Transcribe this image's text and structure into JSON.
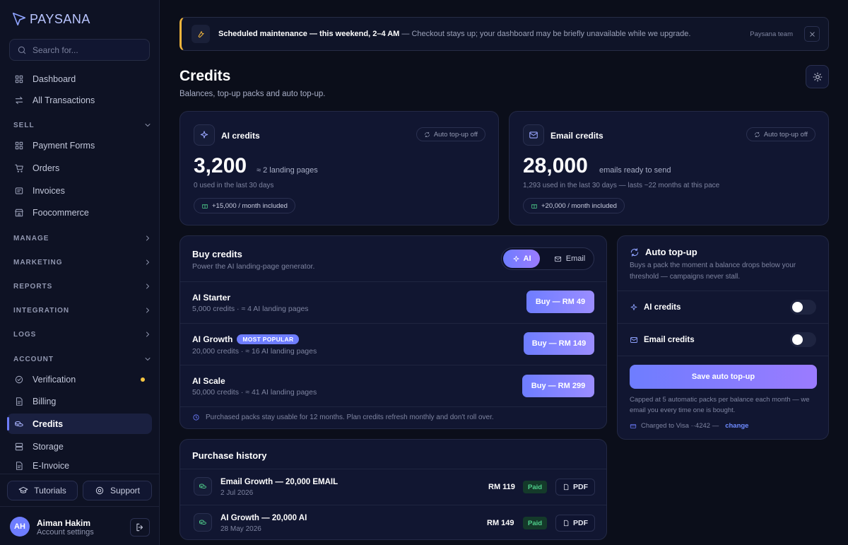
{
  "app": {
    "logo": "PAYSANA"
  },
  "sidebar": {
    "search_placeholder": "Search for...",
    "top_items": [
      {
        "label": "Dashboard",
        "icon": "grid-icon"
      },
      {
        "label": "All Transactions",
        "icon": "arrows-icon"
      }
    ],
    "sections": {
      "sell": "SELL",
      "manage": "MANAGE",
      "marketing": "MARKETING",
      "reports": "REPORTS",
      "integration": "INTEGRATION",
      "logs": "LOGS",
      "account": "ACCOUNT"
    },
    "sell_items": [
      {
        "label": "Payment Forms",
        "icon": "grid-icon"
      },
      {
        "label": "Orders",
        "icon": "cart-icon"
      },
      {
        "label": "Invoices",
        "icon": "invoice-icon"
      },
      {
        "label": "Foocommerce",
        "icon": "store-icon"
      }
    ],
    "account_items": [
      {
        "label": "Verification",
        "icon": "check-circle-icon"
      },
      {
        "label": "Billing",
        "icon": "document-icon"
      },
      {
        "label": "Credits",
        "icon": "coins-icon"
      },
      {
        "label": "Storage",
        "icon": "storage-icon"
      },
      {
        "label": "E-Invoice",
        "icon": "document-icon"
      }
    ],
    "tutorials": "Tutorials",
    "support": "Support",
    "user": {
      "initials": "AH",
      "name": "Aiman Hakim",
      "sub": "Account settings"
    }
  },
  "banner": {
    "title": "Scheduled maintenance — this weekend, 2–4 AM",
    "text": " — Checkout stays up; your dashboard may be briefly unavailable while we upgrade.",
    "team": "Paysana team"
  },
  "page": {
    "title": "Credits",
    "subtitle": "Balances, top-up packs and auto top-up."
  },
  "balances": {
    "ai": {
      "title": "AI credits",
      "auto": "Auto top-up off",
      "value": "3,200",
      "unit": "≈ 2 landing pages",
      "used": "0 used in the last 30 days",
      "included": "+15,000 / month included"
    },
    "email": {
      "title": "Email credits",
      "auto": "Auto top-up off",
      "value": "28,000",
      "unit": "emails ready to send",
      "used": "1,293 used in the last 30 days — lasts ~22 months at this pace",
      "included": "+20,000 / month included"
    }
  },
  "buy": {
    "title": "Buy credits",
    "subtitle": "Power the AI landing-page generator.",
    "tab_ai": "AI",
    "tab_email": "Email",
    "packs": [
      {
        "name": "AI Starter",
        "sub": "5,000 credits · ≈ 4 AI landing pages",
        "button": "Buy — RM 49"
      },
      {
        "name": "AI Growth",
        "badge": "MOST POPULAR",
        "sub": "20,000 credits · ≈ 16 AI landing pages",
        "button": "Buy — RM 149"
      },
      {
        "name": "AI Scale",
        "sub": "50,000 credits · ≈ 41 AI landing pages",
        "button": "Buy — RM 299"
      }
    ],
    "note": "Purchased packs stay usable for 12 months. Plan credits refresh monthly and don't roll over."
  },
  "history": {
    "title": "Purchase history",
    "rows": [
      {
        "name": "Email Growth — 20,000 EMAIL",
        "date": "2 Jul 2026",
        "amount": "RM 119",
        "status": "Paid",
        "pdf": "PDF"
      },
      {
        "name": "AI Growth — 20,000 AI",
        "date": "28 May 2026",
        "amount": "RM 149",
        "status": "Paid",
        "pdf": "PDF"
      }
    ]
  },
  "autotopup": {
    "title": "Auto top-up",
    "desc": "Buys a pack the moment a balance drops below your threshold — campaigns never stall.",
    "ai_label": "AI credits",
    "email_label": "Email credits",
    "ai_enabled": false,
    "email_enabled": false,
    "save": "Save auto top-up",
    "cap": "Capped at 5 automatic packs per balance each month — we email you every time one is bought.",
    "charged": "Charged to Visa ··4242 —",
    "change": "change"
  },
  "colors": {
    "accent": "#6e7dff",
    "warning": "#f0b43c",
    "success": "#4fd08c",
    "background": "#0b0e1a"
  }
}
